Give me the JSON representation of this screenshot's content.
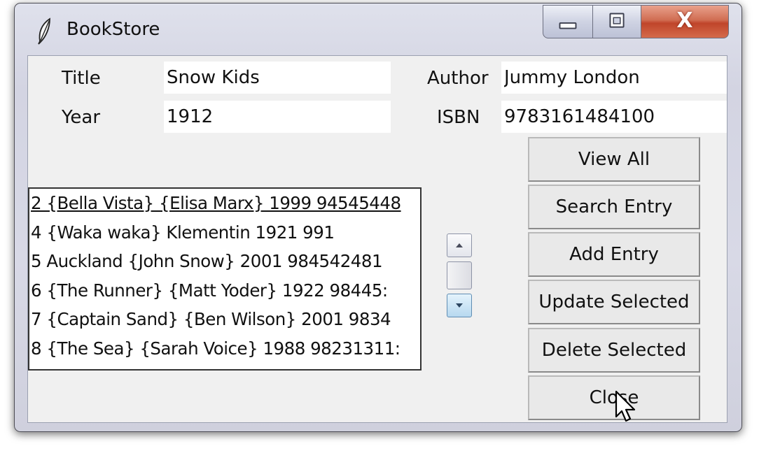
{
  "window": {
    "title": "BookStore",
    "app_icon": "feather-icon",
    "controls": {
      "minimize_icon": "minimize-icon",
      "maximize_icon": "maximize-icon",
      "close_label": "X"
    }
  },
  "form": {
    "title_label": "Title",
    "title_value": "Snow Kids",
    "author_label": "Author",
    "author_value": "Jummy London",
    "year_label": "Year",
    "year_value": "1912",
    "isbn_label": "ISBN",
    "isbn_value": "9783161484100"
  },
  "listbox": {
    "items": [
      "2 {Bella Vista} {Elisa Marx} 1999 94545448",
      "4 {Waka waka} Klementin 1921 991",
      "5 Auckland {John Snow} 2001 984542481",
      "6 {The Runner} {Matt Yoder} 1922 98445:",
      "7 {Captain Sand} {Ben Wilson} 2001 9834",
      "8 {The Sea} {Sarah Voice} 1988 98231311:"
    ],
    "active_index": 0
  },
  "scrollbar": {
    "up_icon": "scroll-up-arrow-icon",
    "down_icon": "scroll-down-arrow-icon"
  },
  "buttons": {
    "view_all": "View All",
    "search_entry": "Search Entry",
    "add_entry": "Add Entry",
    "update_selected": "Update Selected",
    "delete_selected": "Delete Selected",
    "close": "Close"
  },
  "colors": {
    "client_bg": "#f0f0f0",
    "close_button_red": "#c0452a",
    "scroll_down_blue": "#b7d8ef"
  }
}
